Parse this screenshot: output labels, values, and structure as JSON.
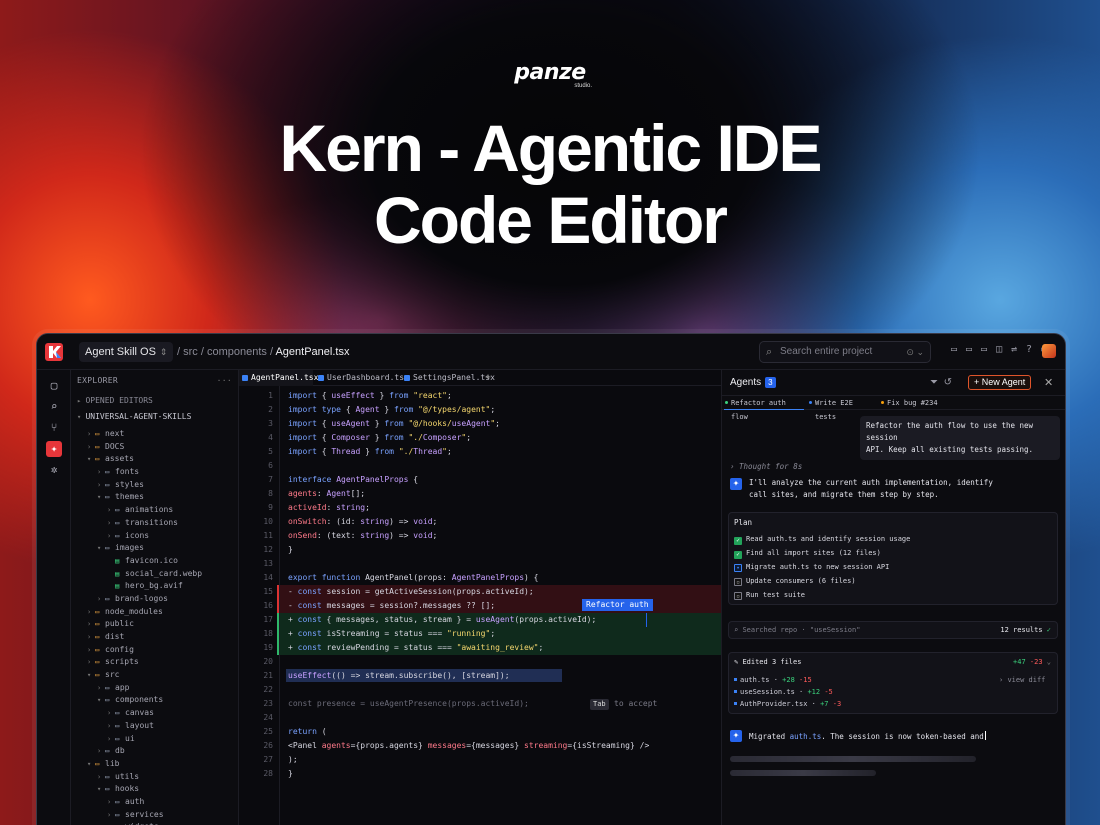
{
  "hero": {
    "brand": "panze",
    "brand_sub": "studio.",
    "title_line1": "Kern - Agentic IDE",
    "title_line2": "Code Editor"
  },
  "topbar": {
    "project": "Agent Skill OS",
    "crumb1": "src",
    "crumb2": "components",
    "crumb_current": "AgentPanel.tsx",
    "search_placeholder": "Search entire project",
    "accent": "#e7363a"
  },
  "explorer": {
    "header": "EXPLORER",
    "opened_editors": "OPENED EDITORS",
    "root": "UNIVERSAL-AGENT-SKILLS",
    "items": [
      {
        "label": "next",
        "depth": 1,
        "type": "folder",
        "open": false
      },
      {
        "label": "DOCS",
        "depth": 1,
        "type": "folder",
        "open": false
      },
      {
        "label": "assets",
        "depth": 1,
        "type": "folder",
        "open": true
      },
      {
        "label": "fonts",
        "depth": 2,
        "type": "folder",
        "open": false
      },
      {
        "label": "styles",
        "depth": 2,
        "type": "folder",
        "open": false
      },
      {
        "label": "themes",
        "depth": 2,
        "type": "folder",
        "open": true
      },
      {
        "label": "animations",
        "depth": 3,
        "type": "folder",
        "open": false
      },
      {
        "label": "transitions",
        "depth": 3,
        "type": "folder",
        "open": false
      },
      {
        "label": "icons",
        "depth": 3,
        "type": "folder",
        "open": false
      },
      {
        "label": "images",
        "depth": 2,
        "type": "folder",
        "open": true
      },
      {
        "label": "favicon.ico",
        "depth": 3,
        "type": "file"
      },
      {
        "label": "social_card.webp",
        "depth": 3,
        "type": "file"
      },
      {
        "label": "hero_bg.avif",
        "depth": 3,
        "type": "file"
      },
      {
        "label": "brand-logos",
        "depth": 2,
        "type": "folder",
        "open": false
      },
      {
        "label": "node_modules",
        "depth": 1,
        "type": "folder",
        "open": false
      },
      {
        "label": "public",
        "depth": 1,
        "type": "folder",
        "open": false
      },
      {
        "label": "dist",
        "depth": 1,
        "type": "folder",
        "open": false
      },
      {
        "label": "config",
        "depth": 1,
        "type": "folder",
        "open": false
      },
      {
        "label": "scripts",
        "depth": 1,
        "type": "folder",
        "open": false
      },
      {
        "label": "src",
        "depth": 1,
        "type": "folder",
        "open": true
      },
      {
        "label": "app",
        "depth": 2,
        "type": "folder",
        "open": false
      },
      {
        "label": "components",
        "depth": 2,
        "type": "folder",
        "open": true
      },
      {
        "label": "canvas",
        "depth": 3,
        "type": "folder",
        "open": false
      },
      {
        "label": "layout",
        "depth": 3,
        "type": "folder",
        "open": false
      },
      {
        "label": "ui",
        "depth": 3,
        "type": "folder",
        "open": false
      },
      {
        "label": "db",
        "depth": 2,
        "type": "folder",
        "open": false
      },
      {
        "label": "lib",
        "depth": 1,
        "type": "folder",
        "open": true
      },
      {
        "label": "utils",
        "depth": 2,
        "type": "folder",
        "open": false
      },
      {
        "label": "hooks",
        "depth": 2,
        "type": "folder",
        "open": true
      },
      {
        "label": "auth",
        "depth": 3,
        "type": "folder",
        "open": false
      },
      {
        "label": "services",
        "depth": 3,
        "type": "folder",
        "open": false
      },
      {
        "label": "widgets",
        "depth": 3,
        "type": "folder",
        "open": false
      }
    ]
  },
  "editor": {
    "tabs": [
      "AgentPanel.tsx",
      "UserDashboard.tsx",
      "SettingsPanel.tsx"
    ],
    "refactor_label": "Refactor auth",
    "tab_key": "Tab",
    "tab_hint": "to accept",
    "lines": [
      "import { useEffect } from \"react\";",
      "import type { Agent } from \"@/types/agent\";",
      "import { useAgent } from \"@/hooks/useAgent\";",
      "import { Composer } from \"./Composer\";",
      "import { Thread } from \"./Thread\";",
      "",
      "interface AgentPanelProps {",
      "agents: Agent[];",
      "activeId: string;",
      "onSwitch: (id: string) => void;",
      "onSend: (text: string) => void;",
      "}",
      "",
      "export function AgentPanel(props: AgentPanelProps) {",
      "- const session = getActiveSession(props.activeId);",
      "- const messages = session?.messages ?? [];",
      "+ const { messages, status, stream } = useAgent(props.activeId);",
      "+ const isStreaming = status === \"running\";",
      "+ const reviewPending = status === \"awaiting_review\";",
      "",
      "useEffect(() => stream.subscribe(), [stream]);",
      "",
      "const presence = useAgentPresence(props.activeId);",
      "",
      "return (",
      "<Panel agents={props.agents} messages={messages} streaming={isStreaming} />",
      ");",
      "}"
    ]
  },
  "agents": {
    "title": "Agents",
    "count": "3",
    "new_label": "New Agent",
    "tabs": [
      {
        "label": "Refactor auth flow",
        "dot": "#3ad17c"
      },
      {
        "label": "Write E2E tests",
        "dot": "#3b82f6"
      },
      {
        "label": "Fix bug #234",
        "dot": "#f59e0b"
      }
    ],
    "user_msg_1": "Refactor the auth flow to use the new session",
    "user_msg_2": "API. Keep all existing tests passing.",
    "thought": "Thought for 8s",
    "bot_msg_1": "I'll analyze the current auth implementation, identify",
    "bot_msg_2": "call sites, and migrate them step by step.",
    "plan_title": "Plan",
    "plan": [
      {
        "label": "Read auth.ts and identify session usage",
        "state": "done"
      },
      {
        "label": "Find all import sites (12 files)",
        "state": "done"
      },
      {
        "label": "Migrate auth.ts to new session API",
        "state": "active"
      },
      {
        "label": "Update consumers (6 files)",
        "state": "todo"
      },
      {
        "label": "Run test suite",
        "state": "todo"
      }
    ],
    "searched": "Searched repo · \"useSession\"",
    "results": "12 results",
    "edited_title": "Edited 3 files",
    "edited_plus": "+47",
    "edited_minus": "-23",
    "view_diff": "view diff",
    "files": [
      {
        "name": "auth.ts",
        "plus": "+28",
        "minus": "-15"
      },
      {
        "name": "useSession.ts",
        "plus": "+12",
        "minus": "-5"
      },
      {
        "name": "AuthProvider.tsx",
        "plus": "+7",
        "minus": "-3"
      }
    ],
    "bot_final_a": "Migrated",
    "bot_final_file": "auth.ts",
    "bot_final_b": ". The session is now token-based and"
  }
}
